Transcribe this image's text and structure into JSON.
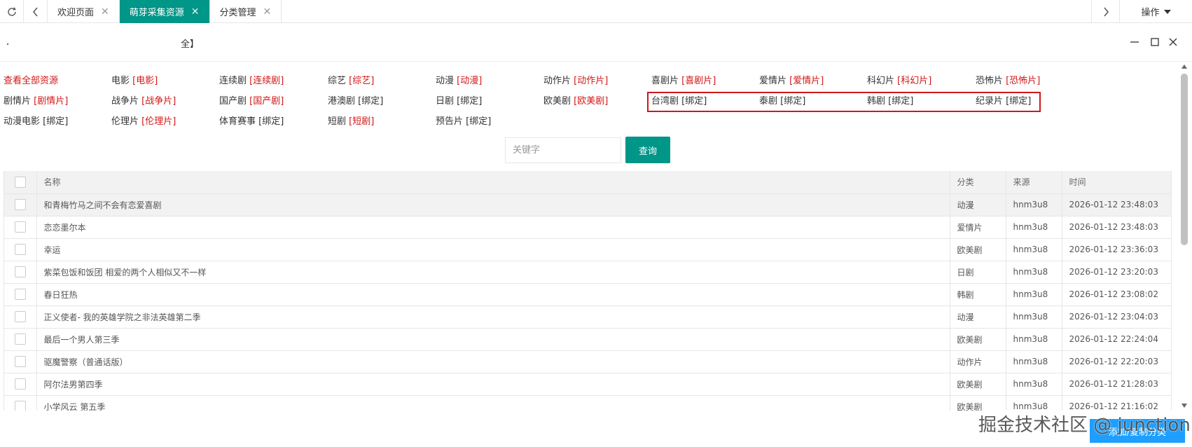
{
  "tabbar": {
    "tabs": [
      {
        "label": "欢迎页面",
        "active": false
      },
      {
        "label": "萌芽采集资源",
        "active": true
      },
      {
        "label": "分类管理",
        "active": false
      }
    ],
    "ops_label": "操作"
  },
  "modal": {
    "title": "全】"
  },
  "categories": [
    {
      "name": "查看全部资源",
      "tag": "",
      "bound": false,
      "all": true
    },
    {
      "name": "电影",
      "tag": "[电影]",
      "bound": false
    },
    {
      "name": "连续剧",
      "tag": "[连续剧]",
      "bound": false
    },
    {
      "name": "综艺",
      "tag": "[综艺]",
      "bound": false
    },
    {
      "name": "动漫",
      "tag": "[动漫]",
      "bound": false
    },
    {
      "name": "动作片",
      "tag": "[动作片]",
      "bound": false
    },
    {
      "name": "喜剧片",
      "tag": "[喜剧片]",
      "bound": false
    },
    {
      "name": "爱情片",
      "tag": "[爱情片]",
      "bound": false
    },
    {
      "name": "科幻片",
      "tag": "[科幻片]",
      "bound": false
    },
    {
      "name": "恐怖片",
      "tag": "[恐怖片]",
      "bound": false
    },
    {
      "name": "剧情片",
      "tag": "[剧情片]",
      "bound": false
    },
    {
      "name": "战争片",
      "tag": "[战争片]",
      "bound": false
    },
    {
      "name": "国产剧",
      "tag": "[国产剧]",
      "bound": false
    },
    {
      "name": "港澳剧",
      "tag": "[绑定]",
      "bound": true
    },
    {
      "name": "日剧",
      "tag": "[绑定]",
      "bound": true
    },
    {
      "name": "欧美剧",
      "tag": "[欧美剧]",
      "bound": false
    },
    {
      "name": "台湾剧",
      "tag": "[绑定]",
      "bound": true
    },
    {
      "name": "泰剧",
      "tag": "[绑定]",
      "bound": true
    },
    {
      "name": "韩剧",
      "tag": "[绑定]",
      "bound": true
    },
    {
      "name": "纪录片",
      "tag": "[绑定]",
      "bound": true
    },
    {
      "name": "动漫电影",
      "tag": "[绑定]",
      "bound": true
    },
    {
      "name": "伦理片",
      "tag": "[伦理片]",
      "bound": false
    },
    {
      "name": "体育赛事",
      "tag": "[绑定]",
      "bound": true
    },
    {
      "name": "短剧",
      "tag": "[短剧]",
      "bound": false
    },
    {
      "name": "预告片",
      "tag": "[绑定]",
      "bound": true
    }
  ],
  "search": {
    "placeholder": "关键字",
    "button_label": "查询"
  },
  "table": {
    "headers": {
      "name": "名称",
      "category": "分类",
      "source": "来源",
      "time": "时间"
    },
    "rows": [
      {
        "name": "和青梅竹马之间不会有恋爱喜剧",
        "category": "动漫",
        "source": "hnm3u8",
        "time": "2026-01-12 23:48:03"
      },
      {
        "name": "恋恋墨尔本",
        "category": "爱情片",
        "source": "hnm3u8",
        "time": "2026-01-12 23:48:03"
      },
      {
        "name": "幸运",
        "category": "欧美剧",
        "source": "hnm3u8",
        "time": "2026-01-12 23:36:03"
      },
      {
        "name": "紫菜包饭和饭团 相爱的两个人相似又不一样",
        "category": "日剧",
        "source": "hnm3u8",
        "time": "2026-01-12 23:20:03"
      },
      {
        "name": "春日狂热",
        "category": "韩剧",
        "source": "hnm3u8",
        "time": "2026-01-12 23:08:02"
      },
      {
        "name": "正义使者- 我的英雄学院之非法英雄第二季",
        "category": "动漫",
        "source": "hnm3u8",
        "time": "2026-01-12 23:04:03"
      },
      {
        "name": "最后一个男人第三季",
        "category": "欧美剧",
        "source": "hnm3u8",
        "time": "2026-01-12 22:24:04"
      },
      {
        "name": "驱魔警察（普通话版）",
        "category": "动作片",
        "source": "hnm3u8",
        "time": "2026-01-12 22:20:03"
      },
      {
        "name": "阿尔法男第四季",
        "category": "欧美剧",
        "source": "hnm3u8",
        "time": "2026-01-12 21:28:03"
      },
      {
        "name": "小学风云 第五季",
        "category": "欧美剧",
        "source": "hnm3u8",
        "time": "2026-01-12 21:16:02"
      }
    ]
  },
  "add_button_label": "添加/复制分类",
  "watermark": "掘金技术社区 @ junction",
  "colors": {
    "accent": "#009688",
    "tag_red": "#d21717",
    "highlight_box": "#c9191e",
    "blue_button": "#1e9fff"
  }
}
